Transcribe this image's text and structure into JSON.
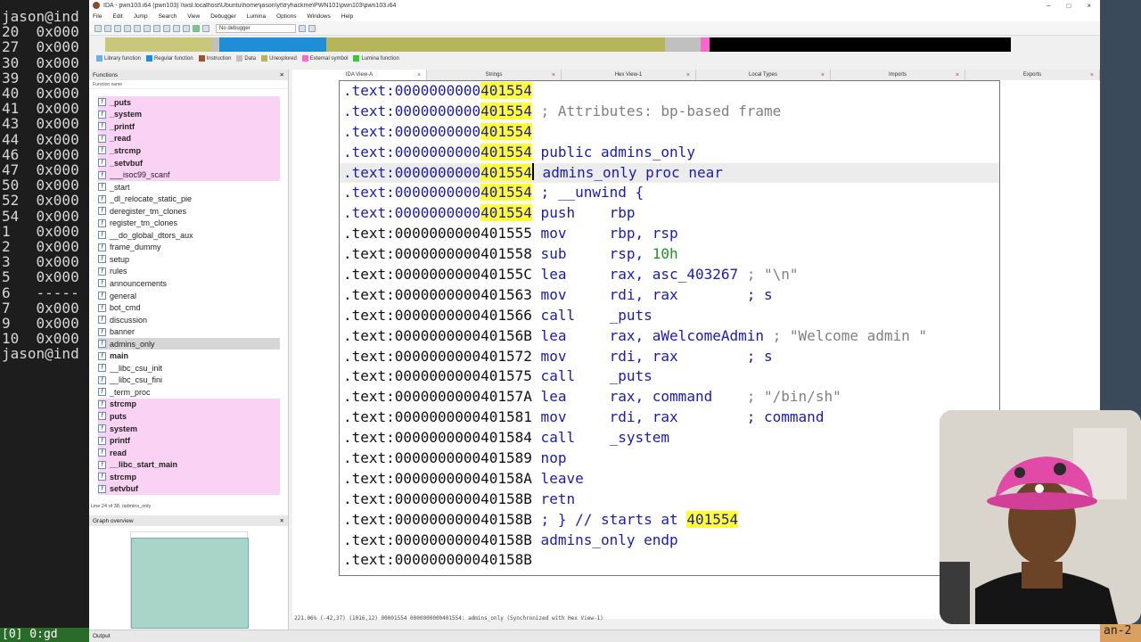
{
  "terminal": {
    "prompt_line": "jason@ind",
    "lines": [
      "20  0x000",
      "27  0x000",
      "30  0x000",
      "39  0x000",
      "40  0x000",
      "41  0x000",
      "43  0x000",
      "44  0x000",
      "46  0x000",
      "47  0x000",
      "50  0x000",
      "52  0x000",
      "54  0x000",
      "1   0x000",
      "2   0x000",
      "3   0x000",
      "5   0x000",
      "6   -----",
      "7   0x000",
      "9   0x000",
      "10  0x000"
    ],
    "prompt_line2": "jason@ind",
    "bottom": "[0] 0:gd",
    "right_strip": "an-2"
  },
  "window": {
    "title": "IDA - pwn103.i64 (pwn103) \\\\wsl.localhost\\Ubuntu\\home\\jason\\yt\\tryhackme\\PWN101\\pwn103\\pwn103.i64",
    "controls": [
      "–",
      "□",
      "×"
    ]
  },
  "menu": [
    "File",
    "Edit",
    "Jump",
    "Search",
    "View",
    "Debugger",
    "Lumina",
    "Options",
    "Windows",
    "Help"
  ],
  "toolbar": {
    "debugger_select": "No debugger"
  },
  "legend": [
    {
      "label": "Library function",
      "color": "#6ab0e8"
    },
    {
      "label": "Regular function",
      "color": "#1e8fd6"
    },
    {
      "label": "Instruction",
      "color": "#a0522d"
    },
    {
      "label": "Data",
      "color": "#c0c0c0"
    },
    {
      "label": "Unexplored",
      "color": "#b5b55a"
    },
    {
      "label": "External symbol",
      "color": "#ff66cc"
    },
    {
      "label": "Lumina function",
      "color": "#33cc33"
    }
  ],
  "tabs": [
    "IDA View-A",
    "Strings",
    "Hex View-1",
    "Local Types",
    "Imports",
    "Exports"
  ],
  "functions_panel": {
    "title": "Functions",
    "column": "Function name",
    "items": [
      {
        "name": "_puts",
        "lib": true,
        "bold": true
      },
      {
        "name": "_system",
        "lib": true,
        "bold": true
      },
      {
        "name": "_printf",
        "lib": true,
        "bold": true
      },
      {
        "name": "_read",
        "lib": true,
        "bold": true
      },
      {
        "name": "_strcmp",
        "lib": true,
        "bold": true
      },
      {
        "name": "_setvbuf",
        "lib": true,
        "bold": true
      },
      {
        "name": "___isoc99_scanf",
        "lib": true,
        "bold": false
      },
      {
        "name": "_start",
        "lib": false,
        "bold": false
      },
      {
        "name": "_dl_relocate_static_pie",
        "lib": false,
        "bold": false
      },
      {
        "name": "deregister_tm_clones",
        "lib": false,
        "bold": false
      },
      {
        "name": "register_tm_clones",
        "lib": false,
        "bold": false
      },
      {
        "name": "__do_global_dtors_aux",
        "lib": false,
        "bold": false
      },
      {
        "name": "frame_dummy",
        "lib": false,
        "bold": false
      },
      {
        "name": "setup",
        "lib": false,
        "bold": false
      },
      {
        "name": "rules",
        "lib": false,
        "bold": false
      },
      {
        "name": "announcements",
        "lib": false,
        "bold": false
      },
      {
        "name": "general",
        "lib": false,
        "bold": false
      },
      {
        "name": "bot_cmd",
        "lib": false,
        "bold": false
      },
      {
        "name": "discussion",
        "lib": false,
        "bold": false
      },
      {
        "name": "banner",
        "lib": false,
        "bold": false
      },
      {
        "name": "admins_only",
        "lib": false,
        "bold": false,
        "selected": true
      },
      {
        "name": "main",
        "lib": false,
        "bold": true
      },
      {
        "name": "__libc_csu_init",
        "lib": false,
        "bold": false
      },
      {
        "name": "__libc_csu_fini",
        "lib": false,
        "bold": false
      },
      {
        "name": "_term_proc",
        "lib": false,
        "bold": false
      },
      {
        "name": "strcmp",
        "lib": true,
        "bold": true
      },
      {
        "name": "puts",
        "lib": true,
        "bold": true
      },
      {
        "name": "system",
        "lib": true,
        "bold": true
      },
      {
        "name": "printf",
        "lib": true,
        "bold": true
      },
      {
        "name": "read",
        "lib": true,
        "bold": true
      },
      {
        "name": "__libc_start_main",
        "lib": true,
        "bold": true
      },
      {
        "name": "strcmp",
        "lib": true,
        "bold": true
      },
      {
        "name": "setvbuf",
        "lib": true,
        "bold": true
      }
    ],
    "status": "Line 24 of 38, /admins_only"
  },
  "graph_overview": {
    "title": "Graph overview"
  },
  "disassembly": {
    "lines": [
      {
        "addr_pre": ".text:0000000000",
        "addr_hl": "401554",
        "addr_post": "",
        "hl": true,
        "text": "",
        "blue": true
      },
      {
        "addr_pre": ".text:0000000000",
        "addr_hl": "401554",
        "addr_post": "",
        "hl": true,
        "text": " ; Attributes: bp-based frame",
        "cls": "cmt",
        "blue": true
      },
      {
        "addr_pre": ".text:0000000000",
        "addr_hl": "401554",
        "addr_post": "",
        "hl": true,
        "text": "",
        "blue": true
      },
      {
        "addr_pre": ".text:0000000000",
        "addr_hl": "401554",
        "addr_post": "",
        "hl": true,
        "text": " public admins_only",
        "cls": "kw",
        "blue": true
      },
      {
        "addr_pre": ".text:0000000000",
        "addr_hl": "401554",
        "addr_post": "",
        "hl": true,
        "text": " admins_only proc near",
        "cls": "kw",
        "blue": true,
        "cur": true
      },
      {
        "addr_pre": ".text:0000000000",
        "addr_hl": "401554",
        "addr_post": "",
        "hl": true,
        "text": " ; __unwind {",
        "cls": "kw",
        "blue": true
      },
      {
        "addr_pre": ".text:0000000000",
        "addr_hl": "401554",
        "addr_post": "",
        "hl": true,
        "text": " push    rbp",
        "cls": "kw",
        "blue": true
      },
      {
        "addr_pre": ".text:0000000000401555",
        "text": " mov     rbp, rsp",
        "cls": "op"
      },
      {
        "addr_pre": ".text:0000000000401558",
        "text": " sub     rsp, ",
        "num": "10h",
        "cls": "op"
      },
      {
        "addr_pre": ".text:000000000040155C",
        "text": " lea     rax, asc_403267",
        "cmt": " ; \"\\n\"",
        "cls": "op"
      },
      {
        "addr_pre": ".text:0000000000401563",
        "text": " mov     rdi, rax",
        "cmt2": "        ; s",
        "cls": "op"
      },
      {
        "addr_pre": ".text:0000000000401566",
        "text": " call    _puts",
        "cls": "op"
      },
      {
        "addr_pre": ".text:000000000040156B",
        "text": " lea     rax, aWelcomeAdmin",
        "cmt": " ; \"Welcome admin \"",
        "cls": "op"
      },
      {
        "addr_pre": ".text:0000000000401572",
        "text": " mov     rdi, rax",
        "cmt2": "        ; s",
        "cls": "op"
      },
      {
        "addr_pre": ".text:0000000000401575",
        "text": " call    _puts",
        "cls": "op"
      },
      {
        "addr_pre": ".text:000000000040157A",
        "text": " lea     rax, command",
        "cmt": "    ; \"/bin/sh\"",
        "cls": "op"
      },
      {
        "addr_pre": ".text:0000000000401581",
        "text": " mov     rdi, rax",
        "cmt2": "        ; command",
        "cls": "op"
      },
      {
        "addr_pre": ".text:0000000000401584",
        "text": " call    _system",
        "cls": "op"
      },
      {
        "addr_pre": ".text:0000000000401589",
        "text": " nop",
        "cls": "op"
      },
      {
        "addr_pre": ".text:000000000040158A",
        "text": " leave",
        "cls": "op"
      },
      {
        "addr_pre": ".text:000000000040158B",
        "text": " retn",
        "cls": "op"
      },
      {
        "addr_pre": ".text:000000000040158B",
        "text": " ; } // starts at ",
        "tail_hl": "401554",
        "cls": "op"
      },
      {
        "addr_pre": ".text:000000000040158B",
        "text": " admins_only endp",
        "cls": "op"
      },
      {
        "addr_pre": ".text:000000000040158B",
        "text": "",
        "cls": "op"
      }
    ],
    "status": "221.06% (-42,37) (1016,12) 00001554 0000000000401554: admins_only (Synchronized with Hex View-1)"
  },
  "output": {
    "title": "Output"
  }
}
